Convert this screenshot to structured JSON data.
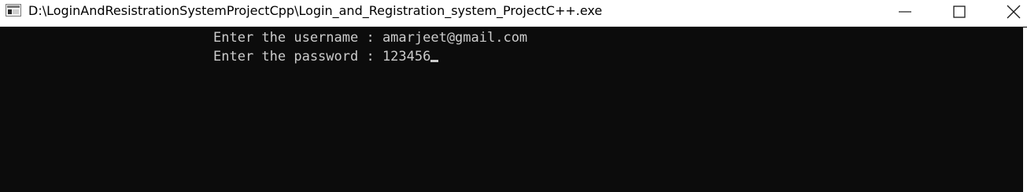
{
  "window": {
    "title": "D:\\LoginAndResistrationSystemProjectCpp\\Login_and_Registration_system_ProjectC++.exe",
    "icons": {
      "app": "console-app-icon",
      "minimize": "minimize-icon",
      "maximize": "maximize-icon",
      "close": "close-icon"
    },
    "colors": {
      "titlebar_bg": "#ffffff",
      "console_bg": "#0c0c0c",
      "console_text": "#cccccc"
    }
  },
  "console": {
    "lines": [
      {
        "prompt": "Enter the username : ",
        "value": "amarjeet@gmail.com"
      },
      {
        "prompt": "Enter the password : ",
        "value": "123456"
      }
    ]
  }
}
